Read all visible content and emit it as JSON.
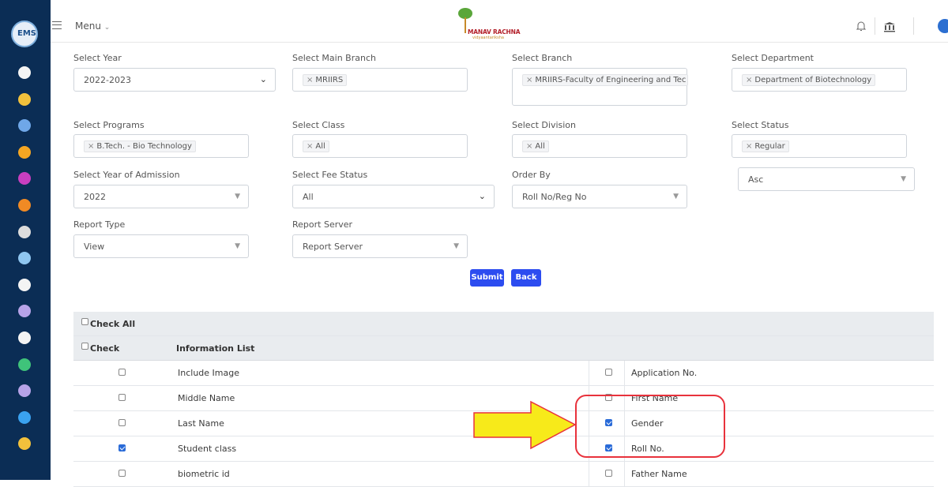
{
  "sidebar": {
    "logo_text": "EMS",
    "icons": [
      {
        "name": "module-icon-1",
        "color": "#f4f4f4"
      },
      {
        "name": "module-icon-2",
        "color": "#f2c13c"
      },
      {
        "name": "module-icon-3",
        "color": "#6fa7e8"
      },
      {
        "name": "module-icon-4",
        "color": "#f5a623"
      },
      {
        "name": "module-icon-5",
        "color": "#c93fbf"
      },
      {
        "name": "module-icon-6",
        "color": "#f08a24"
      },
      {
        "name": "module-icon-7",
        "color": "#dcdcdc"
      },
      {
        "name": "module-icon-8",
        "color": "#8fc6f0"
      },
      {
        "name": "module-icon-9",
        "color": "#f4f4f4"
      },
      {
        "name": "module-icon-10",
        "color": "#b7a3e8"
      },
      {
        "name": "module-icon-11",
        "color": "#f4f4f4"
      },
      {
        "name": "module-icon-12",
        "color": "#3fc37a"
      },
      {
        "name": "module-icon-13",
        "color": "#b7a3e8"
      },
      {
        "name": "module-icon-14",
        "color": "#3aa2f0"
      },
      {
        "name": "module-icon-15",
        "color": "#f2c13c"
      }
    ]
  },
  "topbar": {
    "menu_label": "Menu",
    "brand_name": "MANAV RACHNA",
    "brand_tagline": "vidyaantariksha"
  },
  "filters": {
    "year": {
      "label": "Select Year",
      "value": "2022-2023"
    },
    "main_branch": {
      "label": "Select Main Branch",
      "value": "MRIIRS"
    },
    "branch": {
      "label": "Select Branch",
      "value": "MRIIRS-Faculty of Engineering and Tec"
    },
    "department": {
      "label": "Select Department",
      "value": "Department of Biotechnology"
    },
    "programs": {
      "label": "Select Programs",
      "value": "B.Tech. - Bio Technology"
    },
    "class": {
      "label": "Select Class",
      "value": "All"
    },
    "division": {
      "label": "Select Division",
      "value": "All"
    },
    "status": {
      "label": "Select Status",
      "value": "Regular"
    },
    "year_of_admission": {
      "label": "Select Year of Admission",
      "value": "2022"
    },
    "fee_status": {
      "label": "Select Fee Status",
      "value": "All"
    },
    "order_by": {
      "label": "Order By",
      "value": "Roll No/Reg No"
    },
    "sort_dir": {
      "value": "Asc"
    },
    "report_type": {
      "label": "Report Type",
      "value": "View"
    },
    "report_server": {
      "label": "Report Server",
      "value": "Report Server"
    },
    "remove_symbol": "×"
  },
  "actions": {
    "submit": "Submit",
    "back": "Back"
  },
  "table": {
    "check_all": "Check All",
    "col_check": "Check",
    "col_info": "Information List",
    "rows": [
      {
        "left": {
          "label": "Include Image",
          "checked": false
        },
        "right": {
          "label": "Application No.",
          "checked": false
        }
      },
      {
        "left": {
          "label": "Middle Name",
          "checked": false
        },
        "right": {
          "label": "First Name",
          "checked": false
        }
      },
      {
        "left": {
          "label": "Last Name",
          "checked": false
        },
        "right": {
          "label": "Gender",
          "checked": true
        }
      },
      {
        "left": {
          "label": "Student class",
          "checked": true
        },
        "right": {
          "label": "Roll No.",
          "checked": true
        }
      },
      {
        "left": {
          "label": "biometric id",
          "checked": false
        },
        "right": {
          "label": "Father Name",
          "checked": false
        }
      }
    ]
  },
  "annotation": {
    "arrow_color": "#f7ea1a",
    "box_color": "#e8323c"
  }
}
